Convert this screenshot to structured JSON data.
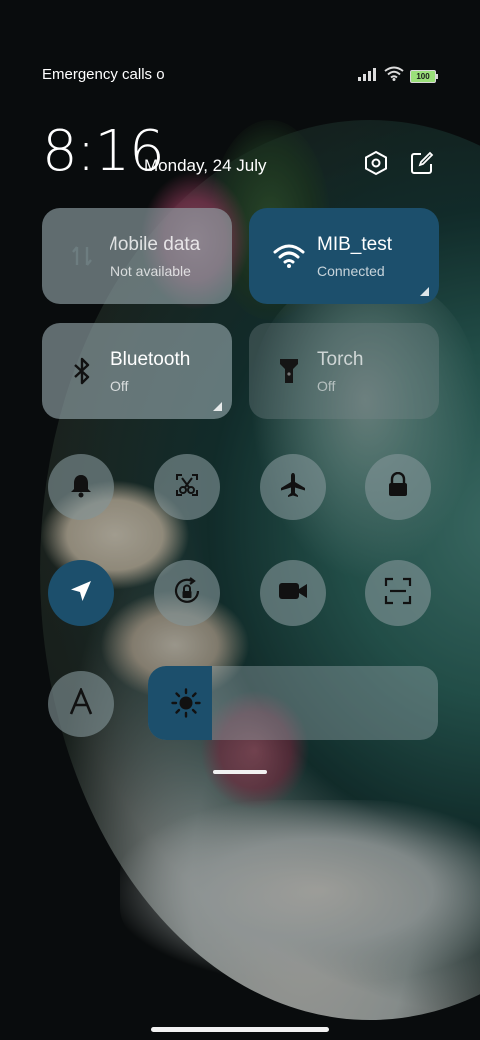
{
  "status_bar": {
    "carrier_text": "Emergency calls o",
    "battery_level": "100"
  },
  "header": {
    "time": "8:16",
    "date": "Monday, 24 July",
    "settings_icon": "hexagon-settings-icon",
    "edit_icon": "edit-icon"
  },
  "tiles": {
    "mobile_data": {
      "title": "Mobile data",
      "subtitle": "Not available",
      "active": false
    },
    "wifi": {
      "title": "MIB_test",
      "subtitle": "Connected",
      "active": true
    },
    "bluetooth": {
      "title": "Bluetooth",
      "subtitle": "Off",
      "active": false
    },
    "torch": {
      "title": "Torch",
      "subtitle": "Off",
      "active": false
    }
  },
  "toggles": [
    {
      "name": "bell-icon",
      "active": false
    },
    {
      "name": "screenshot-icon",
      "active": false
    },
    {
      "name": "airplane-icon",
      "active": false
    },
    {
      "name": "lock-icon",
      "active": false
    },
    {
      "name": "location-icon",
      "active": true
    },
    {
      "name": "rotation-lock-icon",
      "active": false
    },
    {
      "name": "video-camera-icon",
      "active": false
    },
    {
      "name": "scan-icon",
      "active": false
    },
    {
      "name": "font-icon",
      "active": false
    }
  ],
  "brightness": {
    "level_percent": 22
  },
  "colors": {
    "accent": "#1c4f6c",
    "tile": "#96a8ac"
  }
}
